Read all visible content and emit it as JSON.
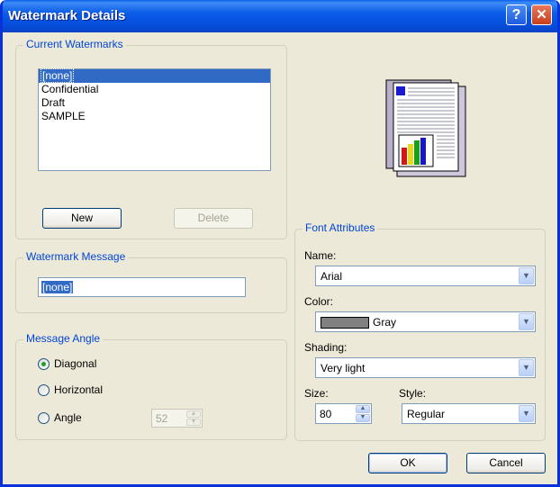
{
  "window": {
    "title": "Watermark Details",
    "help_label": "?",
    "close_label": "✕"
  },
  "current_watermarks": {
    "legend": "Current Watermarks",
    "items": [
      "[none]",
      "Confidential",
      "Draft",
      "SAMPLE"
    ],
    "selected_index": 0,
    "new_label": "New",
    "delete_label": "Delete"
  },
  "watermark_message": {
    "legend": "Watermark Message",
    "value": "[none]"
  },
  "message_angle": {
    "legend": "Message Angle",
    "options": [
      "Diagonal",
      "Horizontal",
      "Angle"
    ],
    "selected": "Diagonal",
    "angle_value": "52"
  },
  "font_attributes": {
    "legend": "Font Attributes",
    "name_label": "Name:",
    "name_value": "Arial",
    "color_label": "Color:",
    "color_value": "Gray",
    "color_hex": "#808080",
    "shading_label": "Shading:",
    "shading_value": "Very light",
    "size_label": "Size:",
    "size_value": "80",
    "style_label": "Style:",
    "style_value": "Regular"
  },
  "buttons": {
    "ok_label": "OK",
    "cancel_label": "Cancel"
  },
  "colors": {
    "titlebar": "#0b5ce6",
    "dialog_bg": "#ece9d8",
    "legend_text": "#0046d5",
    "selection": "#316ac5"
  }
}
